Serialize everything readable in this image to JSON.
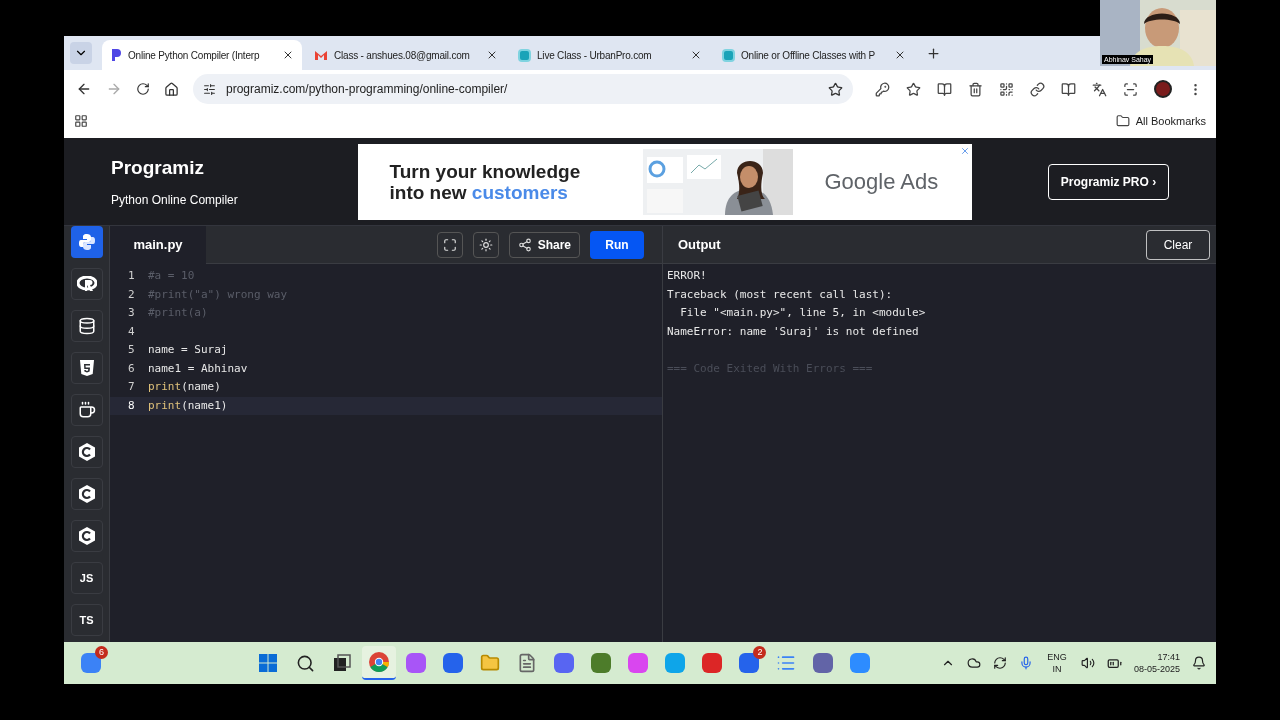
{
  "webcam": {
    "name": "Abhinav Sahay"
  },
  "browser": {
    "tabs": [
      {
        "title": "Online Python Compiler (Interp",
        "kind": "programiz",
        "selected": true
      },
      {
        "title": "Class - anshues.08@gmail.com",
        "kind": "gmail",
        "selected": false
      },
      {
        "title": "Live Class - UrbanPro.com",
        "kind": "urbanpro",
        "selected": false
      },
      {
        "title": "Online or Offline Classes with P",
        "kind": "urbanpro",
        "selected": false
      }
    ],
    "address": "programiz.com/python-programming/online-compiler/",
    "bookmarks": "All Bookmarks"
  },
  "header": {
    "logo": "Programiz",
    "subtitle": "Python Online Compiler",
    "ad": {
      "line1": "Turn your knowledge",
      "line2": "into new **customers**",
      "brand": "Google Ads"
    },
    "pro_button": "Programiz PRO ›"
  },
  "sidebar": [
    {
      "kind": "python",
      "selected": true
    },
    {
      "kind": "r",
      "selected": false
    },
    {
      "kind": "sql",
      "selected": false
    },
    {
      "kind": "html",
      "selected": false
    },
    {
      "kind": "java",
      "selected": false
    },
    {
      "kind": "c",
      "selected": false
    },
    {
      "kind": "cpp",
      "selected": false
    },
    {
      "kind": "csharp",
      "selected": false
    },
    {
      "kind": "text",
      "label": "JS",
      "selected": false
    },
    {
      "kind": "text",
      "label": "TS",
      "selected": false
    }
  ],
  "editor": {
    "file_tab": "main.py",
    "share": "Share",
    "run": "Run",
    "lines": [
      {
        "number": "1",
        "current": false,
        "segments": [
          {
            "text": "#a = 10",
            "kind": "comment"
          }
        ]
      },
      {
        "number": "2",
        "current": false,
        "segments": [
          {
            "text": "#print(\"a\") wrong way",
            "kind": "comment"
          }
        ]
      },
      {
        "number": "3",
        "current": false,
        "segments": [
          {
            "text": "#print(a)",
            "kind": "comment"
          }
        ]
      },
      {
        "number": "4",
        "current": false
      },
      {
        "number": "5",
        "current": false,
        "segments": [
          {
            "text": "name = Suraj",
            "kind": "plain"
          }
        ]
      },
      {
        "number": "6",
        "current": false,
        "segments": [
          {
            "text": "name1 = Abhinav",
            "kind": "plain"
          }
        ]
      },
      {
        "number": "7",
        "current": false,
        "segments": [
          {
            "text": "print",
            "kind": "builtin"
          },
          {
            "text": "(name)",
            "kind": "plain"
          }
        ]
      },
      {
        "number": "8",
        "current": true,
        "segments": [
          {
            "text": "print",
            "kind": "builtin"
          },
          {
            "text": "(name1)",
            "kind": "plain"
          }
        ]
      }
    ]
  },
  "output": {
    "title": "Output",
    "clear": "Clear",
    "lines": [
      {
        "text": "ERROR!",
        "kind": "normal"
      },
      {
        "text": "Traceback (most recent call last):",
        "kind": "normal"
      },
      {
        "text": "  File \"<main.py>\", line 5, in <module>",
        "kind": "normal"
      },
      {
        "text": "NameError: name 'Suraj' is not defined",
        "kind": "normal"
      },
      {
        "text": "=== Code Exited With Errors ===",
        "kind": "status"
      }
    ]
  },
  "taskbar": {
    "apps": [
      {
        "kind": "widgets",
        "badge": "6",
        "selected": false
      },
      {
        "kind": "start",
        "selected": false
      },
      {
        "kind": "search",
        "selected": false
      },
      {
        "kind": "taskview",
        "selected": false
      },
      {
        "kind": "chrome",
        "selected": true
      },
      {
        "kind": "copilot",
        "selected": false
      },
      {
        "kind": "store",
        "selected": false
      },
      {
        "kind": "folder",
        "selected": false
      },
      {
        "kind": "file",
        "selected": false
      },
      {
        "kind": "discord",
        "selected": false
      },
      {
        "kind": "block",
        "selected": false
      },
      {
        "kind": "four",
        "selected": false
      },
      {
        "kind": "edge",
        "selected": false
      },
      {
        "kind": "wps",
        "selected": false
      },
      {
        "kind": "check",
        "badge": "2",
        "selected": false
      },
      {
        "kind": "notepad",
        "selected": false
      },
      {
        "kind": "teams",
        "selected": false
      },
      {
        "kind": "zoom",
        "selected": false
      }
    ],
    "language": "ENG",
    "region": "IN",
    "time": "17:41",
    "date": "08-05-2025"
  }
}
